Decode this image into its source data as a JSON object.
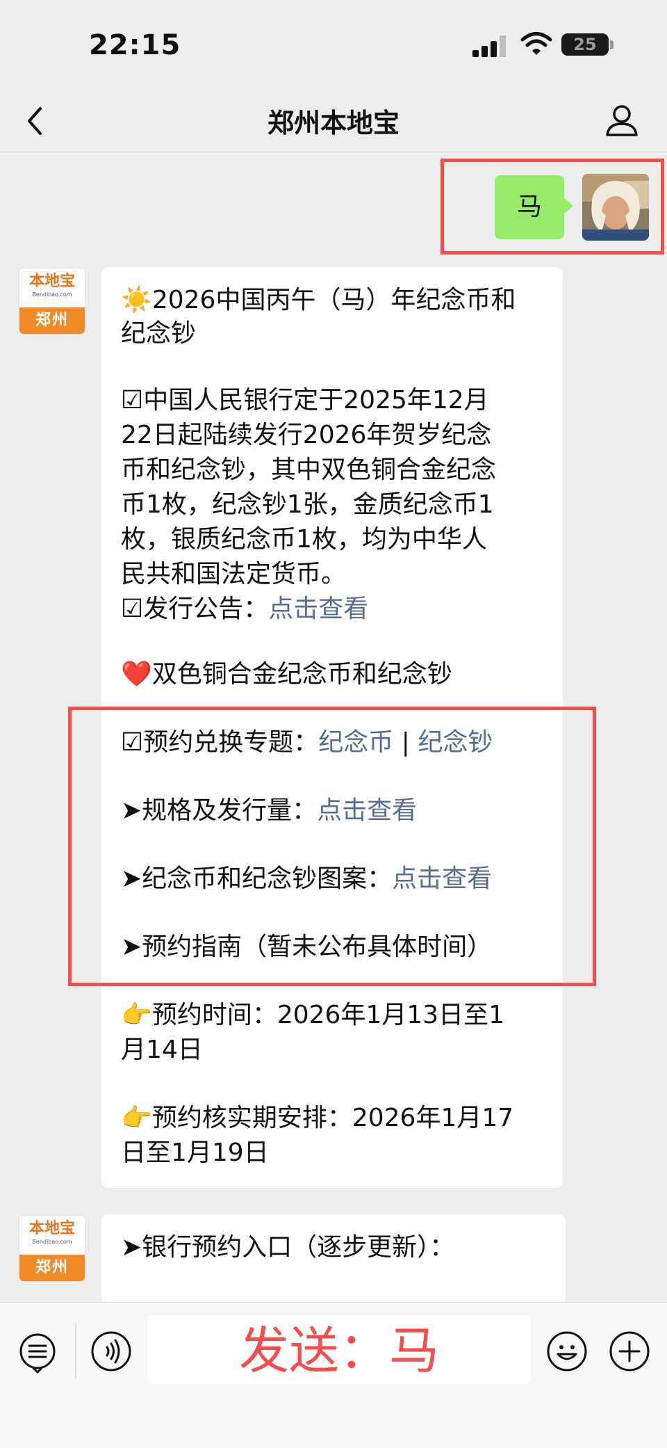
{
  "status_bar": {
    "time": "22:15",
    "battery": "25"
  },
  "nav": {
    "title": "郑州本地宝"
  },
  "sent_message": {
    "text": "马"
  },
  "account": {
    "logo_brand": "本地宝",
    "logo_url": "Bendibao.com",
    "logo_city": "郑州"
  },
  "message1": {
    "title_emoji": "☀️",
    "title_line1": "2026中国丙午（马）年纪念币和",
    "title_line2": "纪念钞",
    "p1_lines": [
      "☑中国人民银行定于2025年12月",
      "22日起陆续发行2026年贺岁纪念",
      "币和纪念钞，其中双色铜合金纪念",
      "币1枚，纪念钞1张，金质纪念币1",
      "枚，银质纪念币1枚，均为中华人",
      "民共和国法定货币。"
    ],
    "announcement_label": "☑发行公告：",
    "announcement_link": "点击查看",
    "heart": "❤️",
    "section_title": "双色铜合金纪念币和纪念钞",
    "booking_topic_label": "☑预约兑换专题：",
    "booking_link_coin": "纪念币",
    "booking_sep": " | ",
    "booking_link_note": "纪念钞",
    "spec_label": "➤规格及发行量：",
    "spec_link": "点击查看",
    "pattern_label": "➤纪念币和纪念钞图案：",
    "pattern_link": "点击查看",
    "guide": "➤预约指南（暂未公布具体时间）",
    "time_line1": "👉预约时间：2026年1月13日至1",
    "time_line2": "月14日",
    "verify_line1": "👉预约核实期安排：2026年1月17",
    "verify_line2": "日至1月19日"
  },
  "message2": {
    "text": "➤银行预约入口（逐步更新）："
  },
  "input_bar": {
    "text": "发送：马"
  },
  "icons": [
    "back-icon",
    "profile-icon",
    "menu-icon",
    "voice-icon",
    "emoji-icon",
    "plus-icon"
  ],
  "colors": {
    "link": "#576b95",
    "sent_bubble": "#95ec69",
    "highlight": "#f24e4e",
    "logo_orange": "#f08a24"
  }
}
